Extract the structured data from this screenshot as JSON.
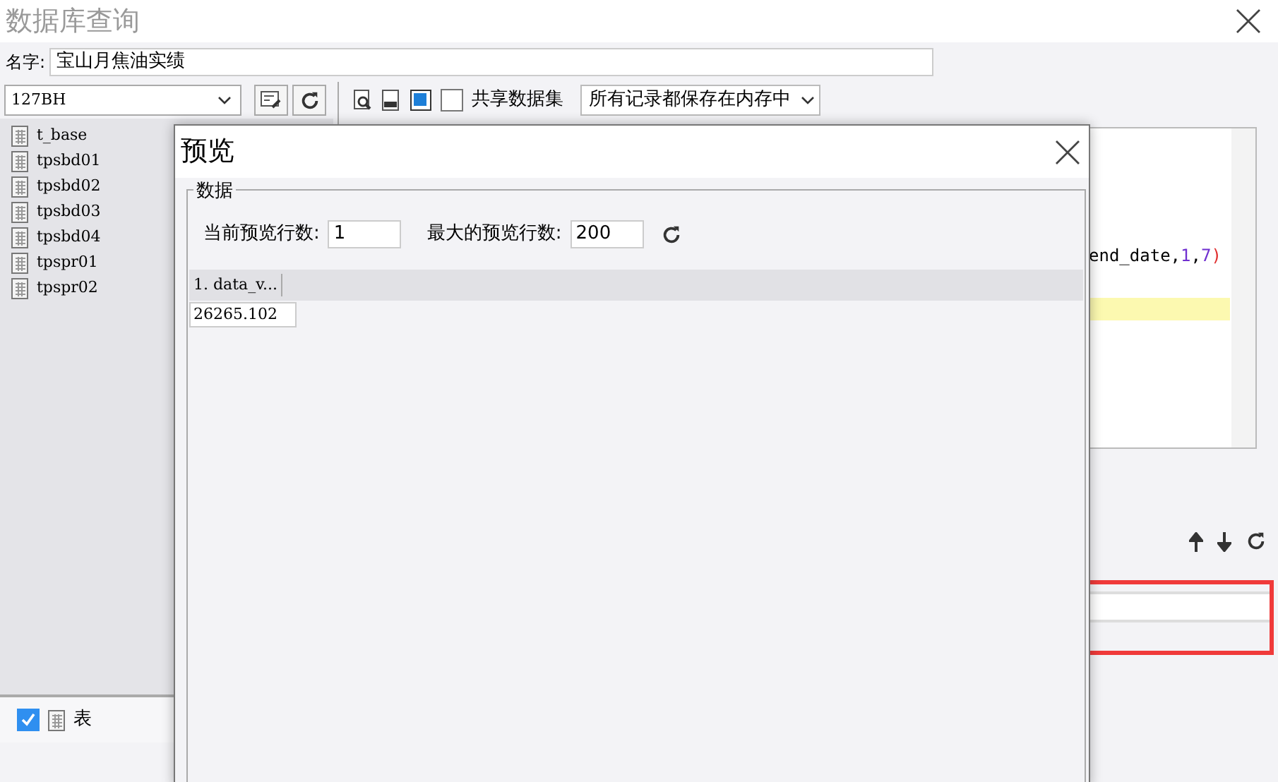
{
  "window": {
    "title": "数据库查询"
  },
  "name_field": {
    "label": "名字:",
    "value": "宝山月焦油实绩"
  },
  "connection": {
    "value": "127BH"
  },
  "share_checkbox": {
    "label": "共享数据集",
    "checked": false
  },
  "storage_select": {
    "value": "所有记录都保存在内存中"
  },
  "tables": [
    {
      "name": "t_base"
    },
    {
      "name": "tpsbd01"
    },
    {
      "name": "tpsbd02"
    },
    {
      "name": "tpsbd03"
    },
    {
      "name": "tpsbd04"
    },
    {
      "name": "tpspr01"
    },
    {
      "name": "tpspr02"
    }
  ],
  "editor": {
    "segments": [
      {
        "text": "end_date,",
        "kind": "plain"
      },
      {
        "text": "1",
        "kind": "number"
      },
      {
        "text": ",",
        "kind": "plain"
      },
      {
        "text": "7",
        "kind": "number"
      },
      {
        "text": ")",
        "kind": "paren"
      }
    ]
  },
  "table_checkbox": {
    "label": "表",
    "checked": true
  },
  "preview": {
    "title": "预览",
    "group": "数据",
    "current_rows_label": "当前预览行数:",
    "current_rows": "1",
    "max_rows_label": "最大的预览行数:",
    "max_rows": "200",
    "columns": [
      "1. data_v..."
    ],
    "rows": [
      [
        "26265.102"
      ]
    ]
  }
}
